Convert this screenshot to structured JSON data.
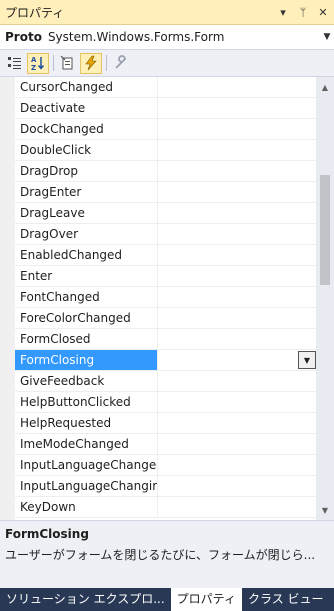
{
  "window": {
    "title": "プロパティ",
    "buttons": [
      "▾",
      "ᛘ",
      "✕"
    ]
  },
  "object_selector": {
    "name": "Proto",
    "type": "System.Windows.Forms.Form"
  },
  "toolbar": {
    "icons": [
      "categorized-icon",
      "alphabetical-icon",
      "properties-icon",
      "events-icon",
      "property-pages-icon"
    ]
  },
  "grid": {
    "rows": [
      {
        "name": "CursorChanged",
        "value": ""
      },
      {
        "name": "Deactivate",
        "value": ""
      },
      {
        "name": "DockChanged",
        "value": ""
      },
      {
        "name": "DoubleClick",
        "value": ""
      },
      {
        "name": "DragDrop",
        "value": ""
      },
      {
        "name": "DragEnter",
        "value": ""
      },
      {
        "name": "DragLeave",
        "value": ""
      },
      {
        "name": "DragOver",
        "value": ""
      },
      {
        "name": "EnabledChanged",
        "value": ""
      },
      {
        "name": "Enter",
        "value": ""
      },
      {
        "name": "FontChanged",
        "value": ""
      },
      {
        "name": "ForeColorChanged",
        "value": ""
      },
      {
        "name": "FormClosed",
        "value": ""
      },
      {
        "name": "FormClosing",
        "value": "",
        "selected": true
      },
      {
        "name": "GiveFeedback",
        "value": ""
      },
      {
        "name": "HelpButtonClicked",
        "value": ""
      },
      {
        "name": "HelpRequested",
        "value": ""
      },
      {
        "name": "ImeModeChanged",
        "value": ""
      },
      {
        "name": "InputLanguageChanged",
        "value": ""
      },
      {
        "name": "InputLanguageChanging",
        "value": ""
      },
      {
        "name": "KeyDown",
        "value": ""
      }
    ]
  },
  "description": {
    "title": "FormClosing",
    "text": "ユーザーがフォームを閉じるたびに、フォームが閉じら..."
  },
  "tabs": [
    {
      "label": "ソリューション エクスプロ...",
      "active": false
    },
    {
      "label": "プロパティ",
      "active": true
    },
    {
      "label": "クラス ビュー",
      "active": false
    }
  ],
  "colors": {
    "title_bg": "#ffefbb",
    "selection": "#3399ff",
    "tab_strip": "#293955"
  }
}
